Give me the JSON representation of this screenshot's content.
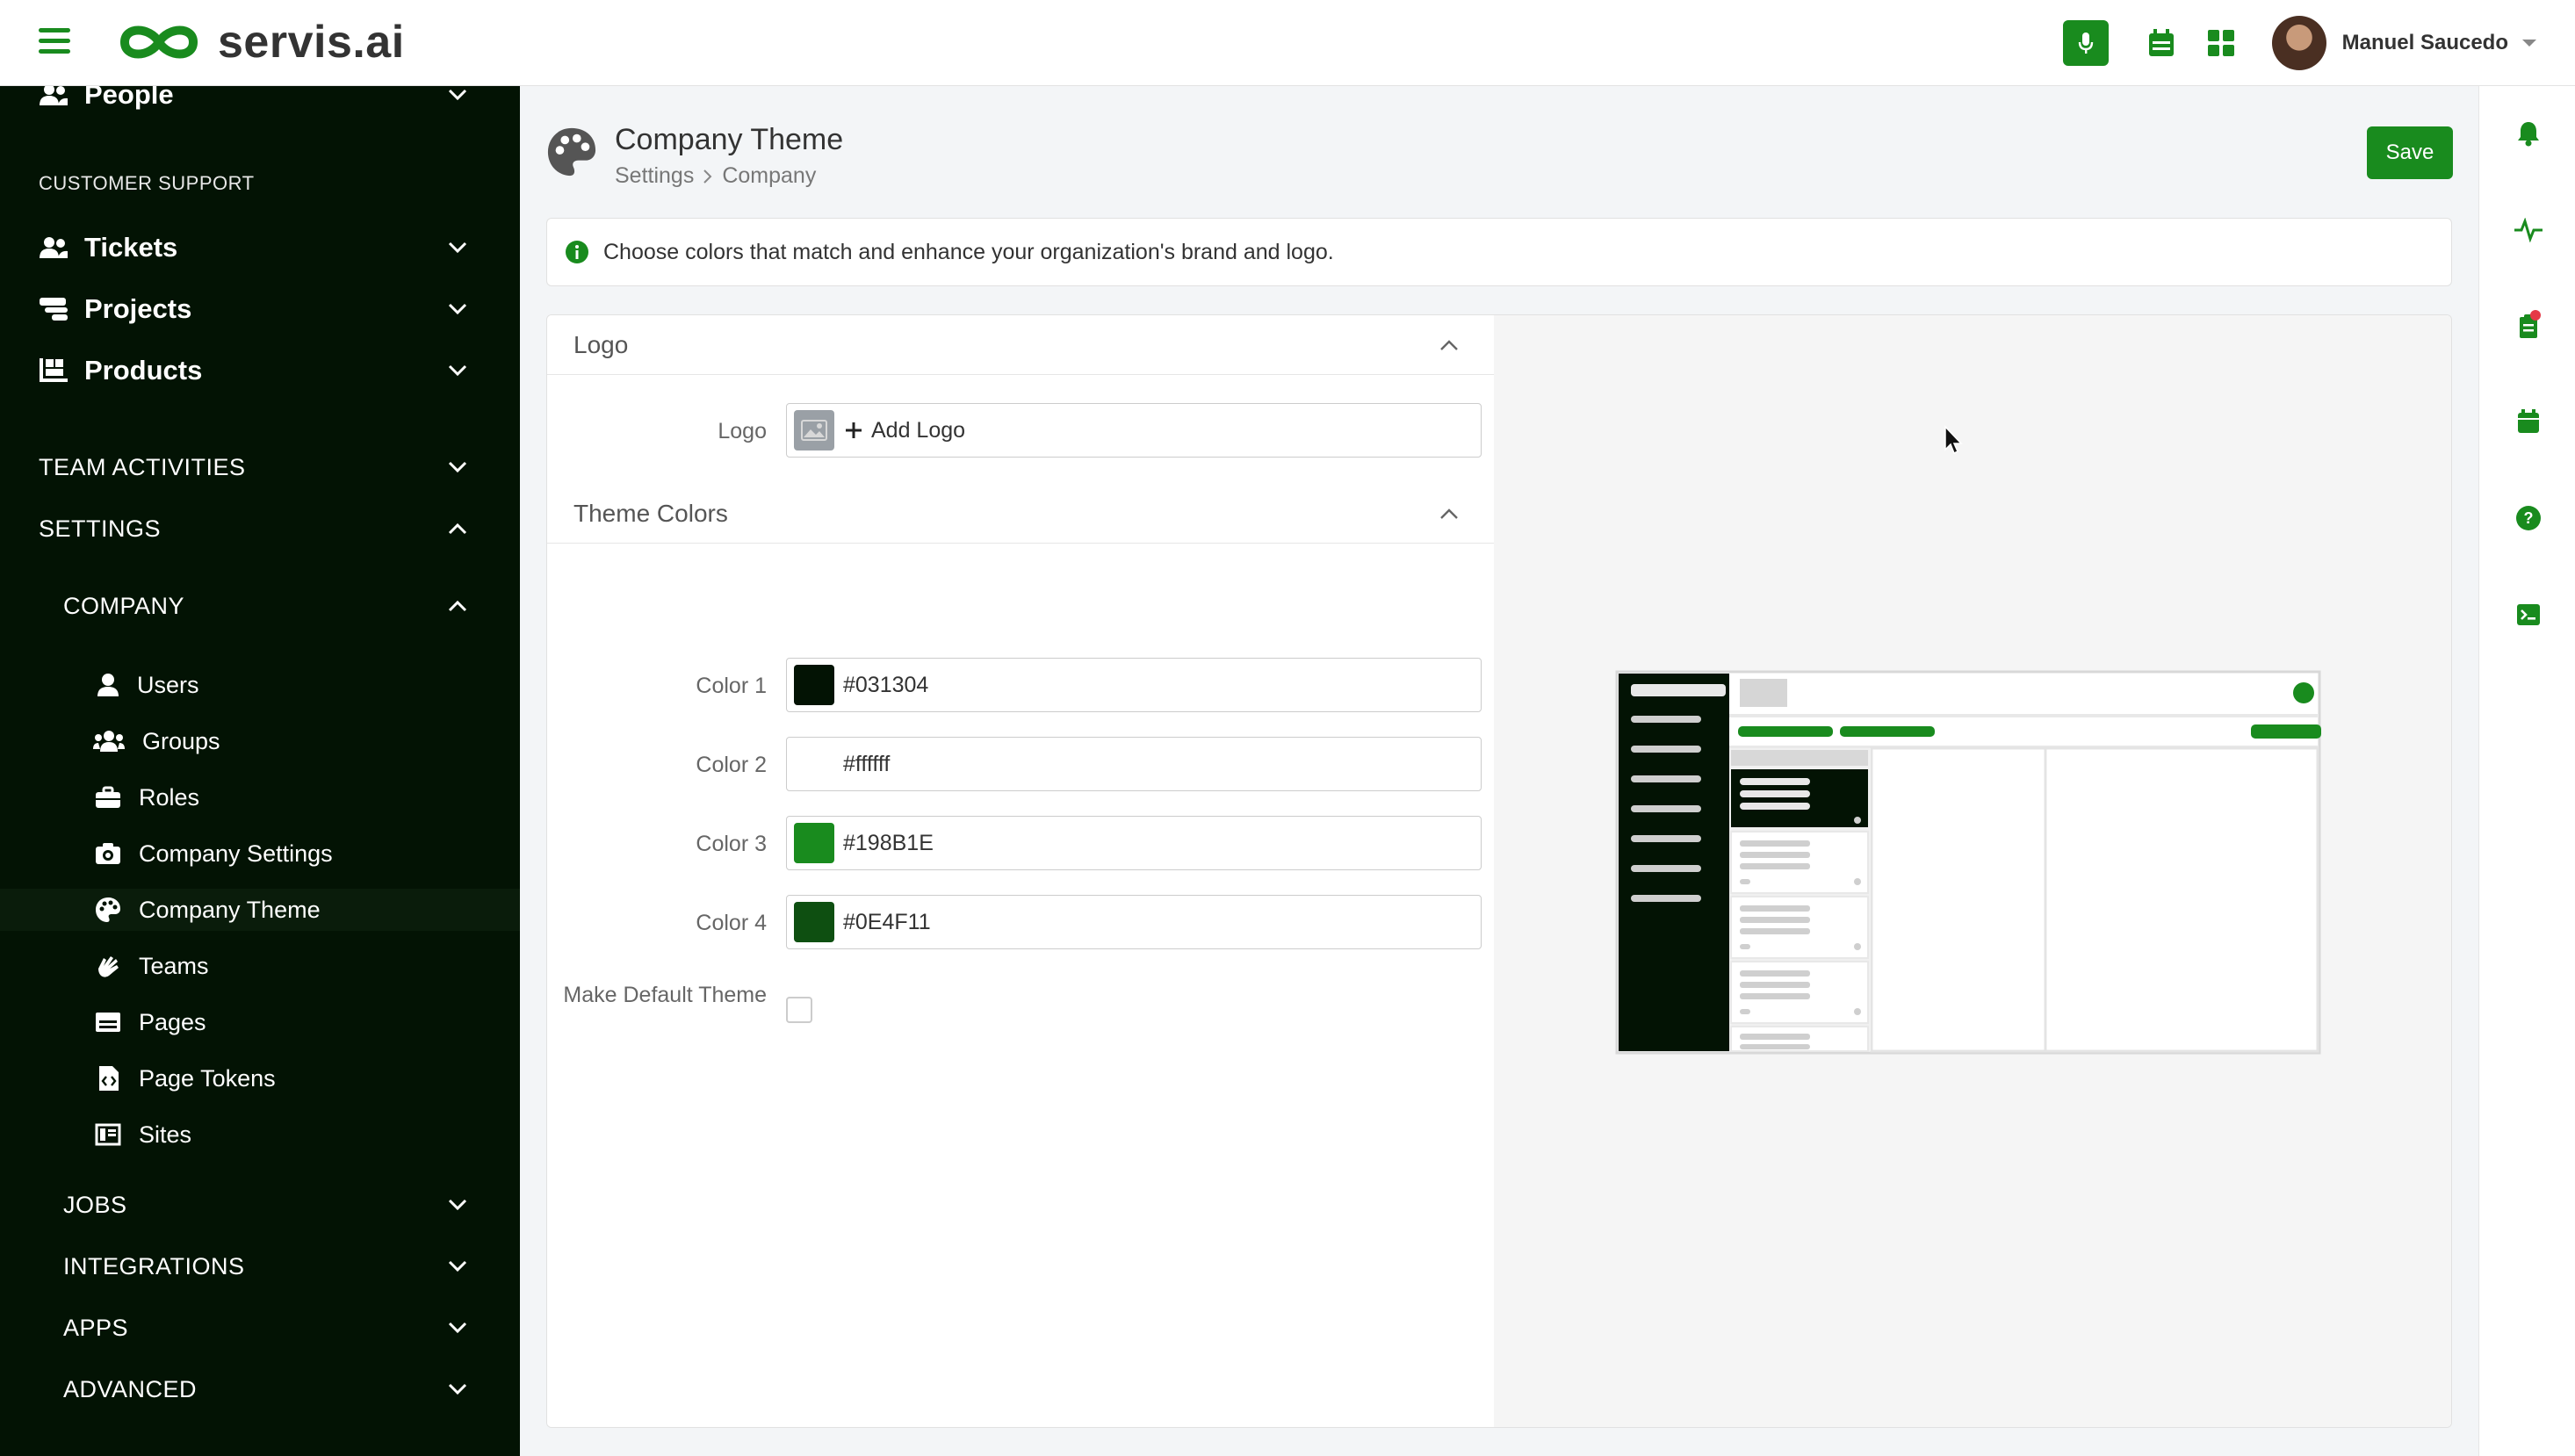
{
  "app": {
    "brand": "servis.ai",
    "accent_color": "#198B1E"
  },
  "header": {
    "user_name": "Manuel Saucedo"
  },
  "sidebar": {
    "people_label": "People",
    "customer_support_title": "CUSTOMER SUPPORT",
    "main_items": [
      {
        "label": "Tickets",
        "icon": "users-icon"
      },
      {
        "label": "Projects",
        "icon": "projects-icon"
      },
      {
        "label": "Products",
        "icon": "products-icon"
      }
    ],
    "team_activities": "TEAM ACTIVITIES",
    "settings": "SETTINGS",
    "company": "COMPANY",
    "company_items": [
      {
        "label": "Users",
        "icon": "user-icon"
      },
      {
        "label": "Groups",
        "icon": "groups-icon"
      },
      {
        "label": "Roles",
        "icon": "briefcase-icon"
      },
      {
        "label": "Company Settings",
        "icon": "camera-icon"
      },
      {
        "label": "Company Theme",
        "icon": "palette-icon"
      },
      {
        "label": "Teams",
        "icon": "hands-icon"
      },
      {
        "label": "Pages",
        "icon": "page-icon"
      },
      {
        "label": "Page Tokens",
        "icon": "file-code-icon"
      },
      {
        "label": "Sites",
        "icon": "sites-icon"
      }
    ],
    "lower_items": [
      "JOBS",
      "INTEGRATIONS",
      "APPS",
      "ADVANCED"
    ]
  },
  "page": {
    "title": "Company Theme",
    "breadcrumb": [
      "Settings",
      "Company"
    ],
    "save_label": "Save",
    "info_text": "Choose colors that match and enhance your organization's brand and logo."
  },
  "logo_section": {
    "title": "Logo",
    "field_label": "Logo",
    "add_logo_label": "Add Logo"
  },
  "theme_colors": {
    "title": "Theme Colors",
    "colors": [
      {
        "label": "Color 1",
        "value": "#031304"
      },
      {
        "label": "Color 2",
        "value": "#ffffff"
      },
      {
        "label": "Color 3",
        "value": "#198B1E"
      },
      {
        "label": "Color 4",
        "value": "#0E4F11"
      }
    ],
    "make_default_label": "Make Default Theme",
    "make_default_checked": false
  },
  "right_rail": {
    "icons": [
      "bell-icon",
      "activity-icon",
      "tasks-icon",
      "calendar-icon",
      "help-icon",
      "terminal-icon"
    ]
  }
}
